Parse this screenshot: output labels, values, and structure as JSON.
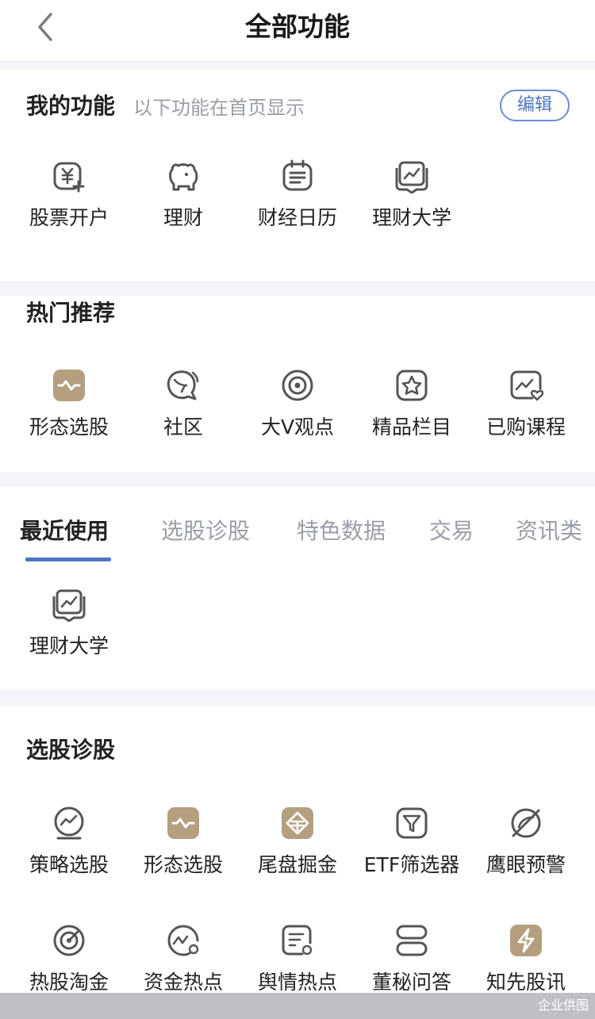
{
  "header": {
    "title": "全部功能",
    "back_icon": "chevron-left-icon"
  },
  "my_functions": {
    "title": "我的功能",
    "subtitle": "以下功能在首页显示",
    "edit_label": "编辑",
    "items": [
      {
        "label": "股票开户",
        "icon": "yuan-plus-icon"
      },
      {
        "label": "理财",
        "icon": "piggy-bank-icon"
      },
      {
        "label": "财经日历",
        "icon": "calendar-icon"
      },
      {
        "label": "理财大学",
        "icon": "chart-book-icon"
      }
    ]
  },
  "hot": {
    "title": "热门推荐",
    "items": [
      {
        "label": "形态选股",
        "icon": "pattern-wave-icon"
      },
      {
        "label": "社区",
        "icon": "community-chat-icon"
      },
      {
        "label": "大V观点",
        "icon": "target-eye-icon"
      },
      {
        "label": "精品栏目",
        "icon": "star-badge-icon"
      },
      {
        "label": "已购课程",
        "icon": "purchased-course-icon"
      }
    ]
  },
  "recent": {
    "tabs": [
      "最近使用",
      "选股诊股",
      "特色数据",
      "交易",
      "资讯类"
    ],
    "active_tab": 0,
    "items": [
      {
        "label": "理财大学",
        "icon": "chart-book-icon"
      }
    ]
  },
  "stock_pick": {
    "title": "选股诊股",
    "items": [
      {
        "label": "策略选股",
        "icon": "strategy-gauge-icon"
      },
      {
        "label": "形态选股",
        "icon": "pattern-wave-icon"
      },
      {
        "label": "尾盘掘金",
        "icon": "gold-dig-icon"
      },
      {
        "label": "ETF筛选器",
        "icon": "filter-icon"
      },
      {
        "label": "鹰眼预警",
        "icon": "eagle-eye-alert-icon"
      },
      {
        "label": "热股淘金",
        "icon": "radar-icon"
      },
      {
        "label": "资金热点",
        "icon": "fund-hotspot-icon"
      },
      {
        "label": "舆情热点",
        "icon": "sentiment-note-icon"
      },
      {
        "label": "董秘问答",
        "icon": "qa-stack-icon"
      },
      {
        "label": "知先股讯",
        "icon": "lightning-icon"
      }
    ]
  },
  "watermark": "企业供图",
  "colors": {
    "accent": "#4f76c6",
    "gold_tile": "#b59f7e",
    "icon_stroke": "#555555"
  }
}
